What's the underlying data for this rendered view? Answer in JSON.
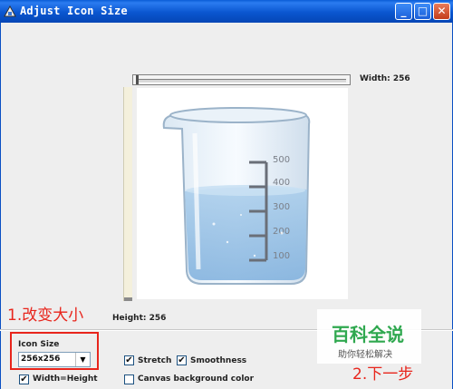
{
  "window": {
    "title": "Adjust Icon Size",
    "minimize_glyph": "_",
    "maximize_glyph": "□",
    "close_glyph": "✕",
    "icon": "app-icon"
  },
  "preview": {
    "width_label": "Width: 256",
    "height_label": "Height: 256",
    "image_icon": "beaker-icon",
    "beaker_scale": [
      "500",
      "400",
      "300",
      "200",
      "100"
    ]
  },
  "annotations": {
    "step1": "1.改变大小",
    "step2": "2.下一步"
  },
  "options": {
    "icon_size_label": "Icon Size",
    "icon_size_value": "256x256",
    "dropdown_arrow": "▼",
    "width_equals_height_label": "Width=Height",
    "width_equals_height_checked": true,
    "stretch_label": "Stretch",
    "stretch_checked": true,
    "smoothness_label": "Smoothness",
    "smoothness_checked": true,
    "canvas_bg_label": "Canvas background color",
    "canvas_bg_checked": false,
    "check_glyph": "✔"
  },
  "watermark": {
    "brand": "百科全说",
    "slogan": "助你轻松解决"
  },
  "colors": {
    "titlebar": "#0a5cd6",
    "annotation_red": "#e8251c",
    "brand_green": "#2fa84f"
  }
}
